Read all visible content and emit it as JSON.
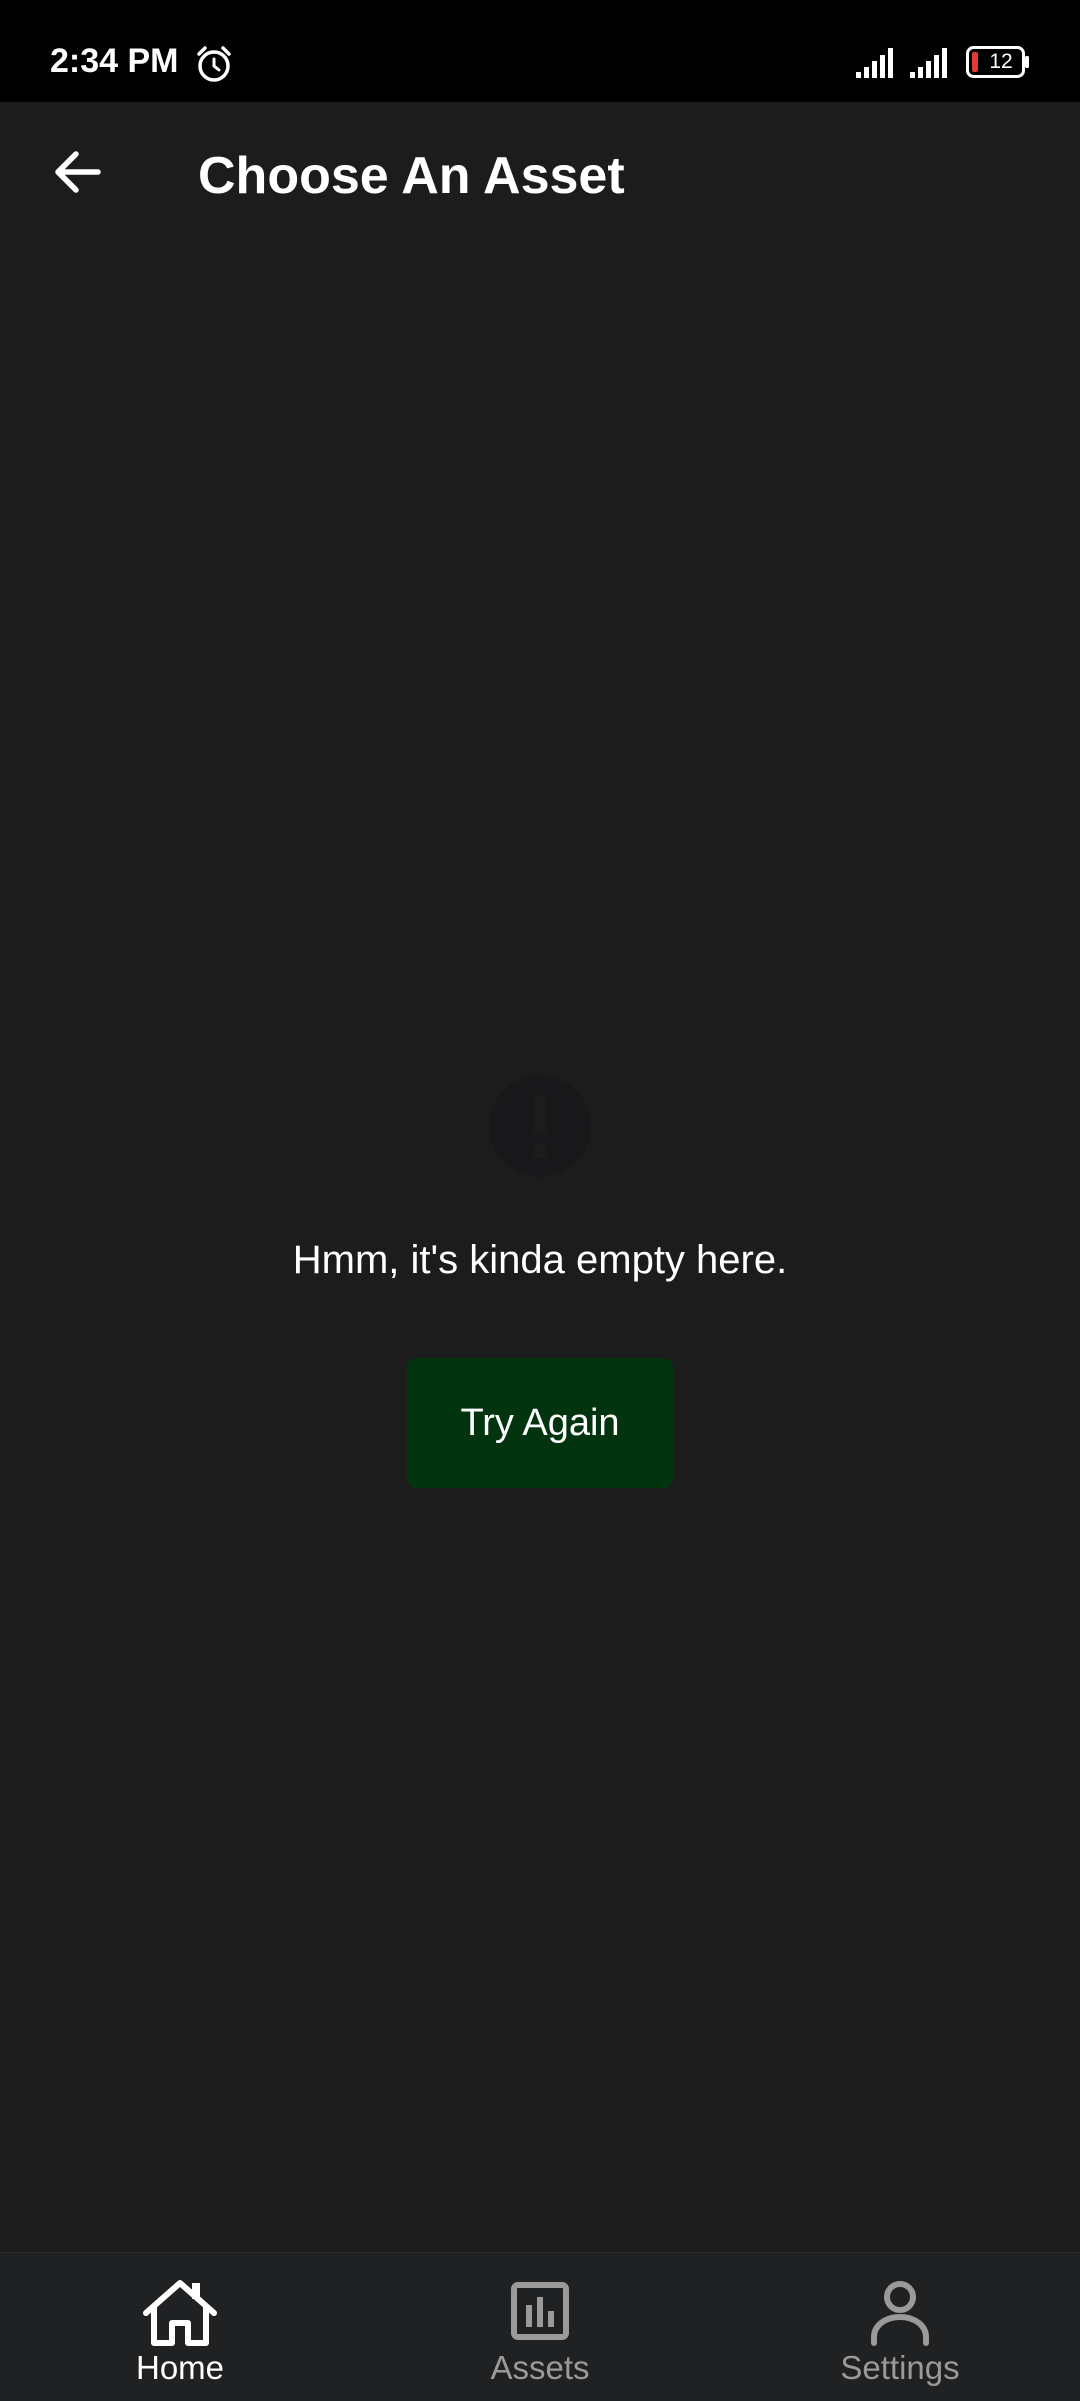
{
  "status_bar": {
    "time": "2:34 PM",
    "battery": "12",
    "icons": [
      "alarm-icon",
      "signal-icon",
      "signal-icon",
      "battery-icon"
    ]
  },
  "header": {
    "title": "Choose An Asset",
    "back_icon": "arrow-left-icon"
  },
  "empty_state": {
    "icon": "warning-icon",
    "message": "Hmm, it's kinda empty here.",
    "retry_label": "Try Again"
  },
  "bottom_nav": {
    "items": [
      {
        "label": "Home",
        "icon": "home-icon",
        "active": true
      },
      {
        "label": "Assets",
        "icon": "bar-chart-icon",
        "active": false
      },
      {
        "label": "Settings",
        "icon": "person-icon",
        "active": false
      }
    ]
  },
  "colors": {
    "background": "#1c1c1c",
    "status_bar": "#000000",
    "button": "#023410",
    "nav_background": "#202123",
    "nav_active": "#ffffff",
    "nav_inactive": "#9a9a9a",
    "battery_low": "#e53935"
  }
}
